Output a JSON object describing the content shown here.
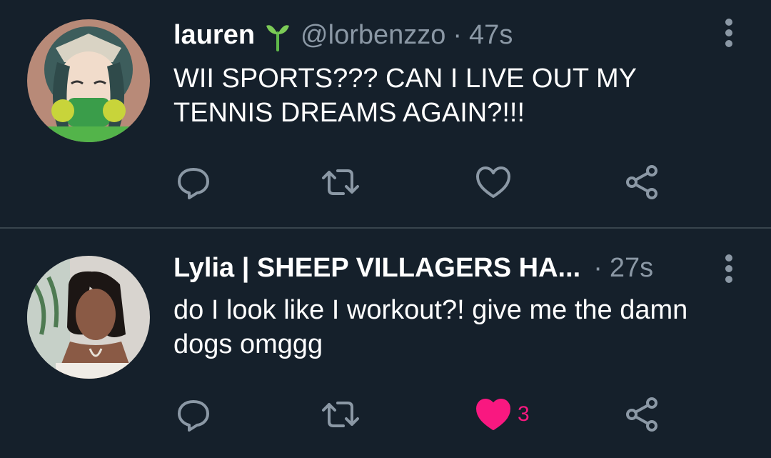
{
  "tweets": [
    {
      "name": "lauren",
      "handle": "@lorbenzzo",
      "separator": "·",
      "time": "47s",
      "text": "WII SPORTS??? CAN I LIVE OUT MY TENNIS DREAMS AGAIN?!!!",
      "liked": false,
      "like_count": ""
    },
    {
      "name": "Lylia | SHEEP VILLAGERS HA...",
      "separator": "·",
      "time": "27s",
      "text": "do I look like I workout?! give me the damn dogs omggg",
      "liked": true,
      "like_count": "3"
    }
  ],
  "colors": {
    "background": "#15202b",
    "secondary_text": "#8b98a5",
    "like_pink": "#f91880",
    "divider": "#38444d"
  },
  "icons": [
    "sprout-emoji-icon",
    "more-icon",
    "reply-icon",
    "retweet-icon",
    "like-icon",
    "share-icon"
  ]
}
